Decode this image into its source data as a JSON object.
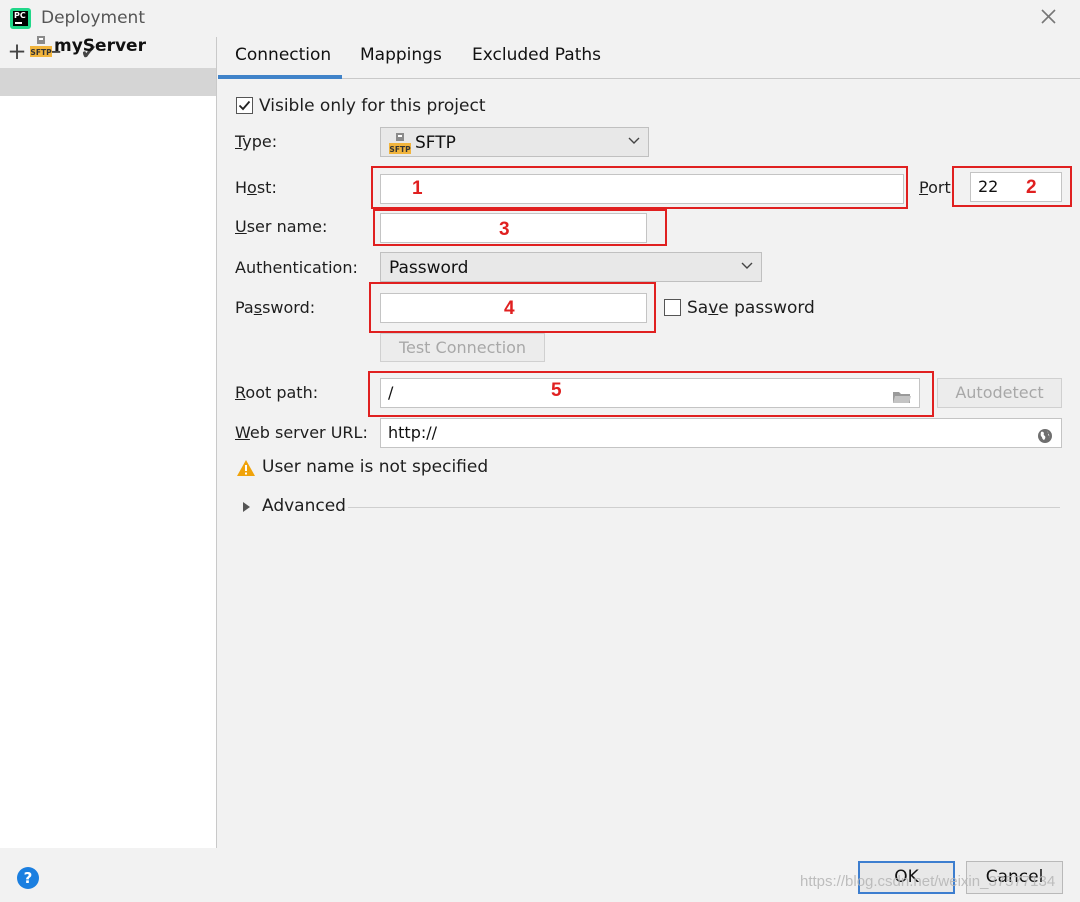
{
  "window": {
    "title": "Deployment",
    "app_icon_text": "PC"
  },
  "left_toolbar": {
    "add": "+",
    "remove": "−",
    "apply": "✔"
  },
  "servers": [
    {
      "name": "myServer",
      "icon": "sftp-icon",
      "icon_text": "SFTP",
      "selected": true
    }
  ],
  "tabs": [
    {
      "label": "Connection",
      "active": true
    },
    {
      "label": "Mappings",
      "active": false
    },
    {
      "label": "Excluded Paths",
      "active": false
    }
  ],
  "form": {
    "visible_only": {
      "label": "Visible only for this project",
      "checked": true
    },
    "type": {
      "label_prefix": "",
      "label_mnemonic": "T",
      "label_rest": "ype:",
      "value": "SFTP",
      "icon_text": "SFTP"
    },
    "host": {
      "label_prefix": "H",
      "label_mnemonic": "o",
      "label_rest": "st:",
      "value": ""
    },
    "port": {
      "label_prefix": "",
      "label_mnemonic": "P",
      "label_rest": "ort",
      "value": "22"
    },
    "user_name": {
      "label_prefix": "",
      "label_mnemonic": "U",
      "label_rest": "ser name:",
      "value": ""
    },
    "authentication": {
      "label": "Authentication:",
      "value": "Password"
    },
    "password": {
      "label_prefix": "Pa",
      "label_mnemonic": "s",
      "label_rest": "sword:",
      "value": ""
    },
    "save_password": {
      "label_prefix": "Sa",
      "label_mnemonic": "v",
      "label_rest": "e password",
      "checked": false
    },
    "test_connection": "Test Connection",
    "root_path": {
      "label_prefix": "",
      "label_mnemonic": "R",
      "label_rest": "oot path:",
      "value": "/"
    },
    "autodetect": "Autodetect",
    "web_server_url": {
      "label_prefix": "",
      "label_mnemonic": "W",
      "label_rest": "eb server URL:",
      "value": "http://"
    },
    "warning": "User name is not specified",
    "advanced": "Advanced"
  },
  "annotations": [
    "1",
    "2",
    "3",
    "4",
    "5"
  ],
  "colors": {
    "annotation": "#e02020",
    "accent": "#4083c9",
    "help": "#1b7fe0",
    "warning": "#f0a30a"
  },
  "buttons": {
    "help": "?",
    "ok": "OK",
    "cancel": "Cancel"
  },
  "watermark": "https://blog.csdn.net/weixin_37577134"
}
